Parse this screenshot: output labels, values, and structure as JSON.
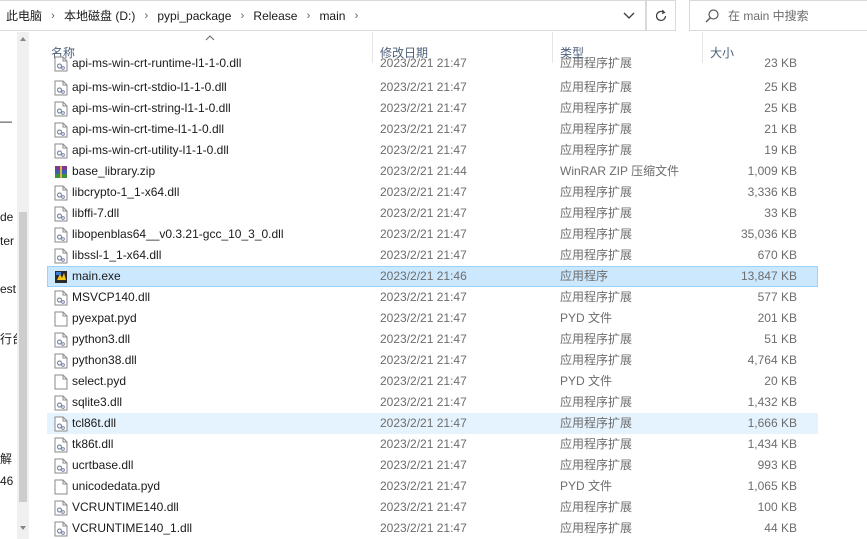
{
  "breadcrumb": {
    "items": [
      "此电脑",
      "本地磁盘 (D:)",
      "pypi_package",
      "Release",
      "main"
    ],
    "separator": "›"
  },
  "search": {
    "placeholder": "在 main 中搜索"
  },
  "nav_fragments": [
    "—",
    "de",
    "ter",
    "est",
    "行台",
    "解",
    "46"
  ],
  "columns": {
    "name": "名称",
    "date": "修改日期",
    "type": "类型",
    "size": "大小"
  },
  "colors": {
    "selected_bg": "#cce8ff",
    "selected_border": "#99d1ff",
    "hover_bg": "#e5f3ff",
    "header_text": "#4c607a"
  },
  "files": [
    {
      "name": "api-ms-win-crt-runtime-l1-1-0.dll",
      "date": "2023/2/21 21:47",
      "type": "应用程序扩展",
      "size": "23 KB",
      "icon": "dll-icon",
      "state": ""
    },
    {
      "name": "api-ms-win-crt-stdio-l1-1-0.dll",
      "date": "2023/2/21 21:47",
      "type": "应用程序扩展",
      "size": "25 KB",
      "icon": "dll-icon",
      "state": ""
    },
    {
      "name": "api-ms-win-crt-string-l1-1-0.dll",
      "date": "2023/2/21 21:47",
      "type": "应用程序扩展",
      "size": "25 KB",
      "icon": "dll-icon",
      "state": ""
    },
    {
      "name": "api-ms-win-crt-time-l1-1-0.dll",
      "date": "2023/2/21 21:47",
      "type": "应用程序扩展",
      "size": "21 KB",
      "icon": "dll-icon",
      "state": ""
    },
    {
      "name": "api-ms-win-crt-utility-l1-1-0.dll",
      "date": "2023/2/21 21:47",
      "type": "应用程序扩展",
      "size": "19 KB",
      "icon": "dll-icon",
      "state": ""
    },
    {
      "name": "base_library.zip",
      "date": "2023/2/21 21:44",
      "type": "WinRAR ZIP 压缩文件",
      "size": "1,009 KB",
      "icon": "zip-icon",
      "state": ""
    },
    {
      "name": "libcrypto-1_1-x64.dll",
      "date": "2023/2/21 21:47",
      "type": "应用程序扩展",
      "size": "3,336 KB",
      "icon": "dll-icon",
      "state": ""
    },
    {
      "name": "libffi-7.dll",
      "date": "2023/2/21 21:47",
      "type": "应用程序扩展",
      "size": "33 KB",
      "icon": "dll-icon",
      "state": ""
    },
    {
      "name": "libopenblas64__v0.3.21-gcc_10_3_0.dll",
      "date": "2023/2/21 21:47",
      "type": "应用程序扩展",
      "size": "35,036 KB",
      "icon": "dll-icon",
      "state": ""
    },
    {
      "name": "libssl-1_1-x64.dll",
      "date": "2023/2/21 21:47",
      "type": "应用程序扩展",
      "size": "670 KB",
      "icon": "dll-icon",
      "state": ""
    },
    {
      "name": "main.exe",
      "date": "2023/2/21 21:46",
      "type": "应用程序",
      "size": "13,847 KB",
      "icon": "exe-icon",
      "state": "selected"
    },
    {
      "name": "MSVCP140.dll",
      "date": "2023/2/21 21:47",
      "type": "应用程序扩展",
      "size": "577 KB",
      "icon": "dll-icon",
      "state": ""
    },
    {
      "name": "pyexpat.pyd",
      "date": "2023/2/21 21:47",
      "type": "PYD 文件",
      "size": "201 KB",
      "icon": "file-icon",
      "state": ""
    },
    {
      "name": "python3.dll",
      "date": "2023/2/21 21:47",
      "type": "应用程序扩展",
      "size": "51 KB",
      "icon": "dll-icon",
      "state": ""
    },
    {
      "name": "python38.dll",
      "date": "2023/2/21 21:47",
      "type": "应用程序扩展",
      "size": "4,764 KB",
      "icon": "dll-icon",
      "state": ""
    },
    {
      "name": "select.pyd",
      "date": "2023/2/21 21:47",
      "type": "PYD 文件",
      "size": "20 KB",
      "icon": "file-icon",
      "state": ""
    },
    {
      "name": "sqlite3.dll",
      "date": "2023/2/21 21:47",
      "type": "应用程序扩展",
      "size": "1,432 KB",
      "icon": "dll-icon",
      "state": ""
    },
    {
      "name": "tcl86t.dll",
      "date": "2023/2/21 21:47",
      "type": "应用程序扩展",
      "size": "1,666 KB",
      "icon": "dll-icon",
      "state": "hover"
    },
    {
      "name": "tk86t.dll",
      "date": "2023/2/21 21:47",
      "type": "应用程序扩展",
      "size": "1,434 KB",
      "icon": "dll-icon",
      "state": ""
    },
    {
      "name": "ucrtbase.dll",
      "date": "2023/2/21 21:47",
      "type": "应用程序扩展",
      "size": "993 KB",
      "icon": "dll-icon",
      "state": ""
    },
    {
      "name": "unicodedata.pyd",
      "date": "2023/2/21 21:47",
      "type": "PYD 文件",
      "size": "1,065 KB",
      "icon": "file-icon",
      "state": ""
    },
    {
      "name": "VCRUNTIME140.dll",
      "date": "2023/2/21 21:47",
      "type": "应用程序扩展",
      "size": "100 KB",
      "icon": "dll-icon",
      "state": ""
    },
    {
      "name": "VCRUNTIME140_1.dll",
      "date": "2023/2/21 21:47",
      "type": "应用程序扩展",
      "size": "44 KB",
      "icon": "dll-icon",
      "state": ""
    }
  ]
}
